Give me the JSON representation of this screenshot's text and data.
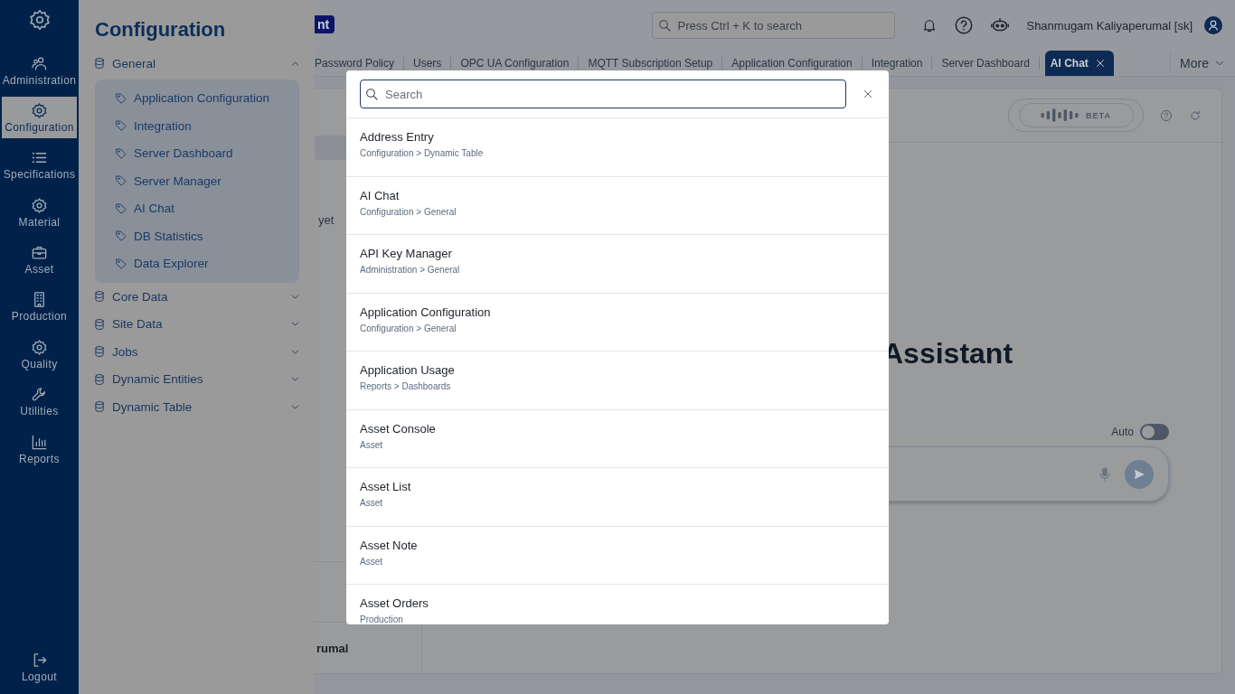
{
  "rail": {
    "items": [
      {
        "label": "Administration",
        "selected": false
      },
      {
        "label": "Configuration",
        "selected": true
      },
      {
        "label": "Specifications",
        "selected": false
      },
      {
        "label": "Material",
        "selected": false
      },
      {
        "label": "Asset",
        "selected": false
      },
      {
        "label": "Production",
        "selected": false
      },
      {
        "label": "Quality",
        "selected": false
      },
      {
        "label": "Utilities",
        "selected": false
      },
      {
        "label": "Reports",
        "selected": false
      }
    ],
    "logout": "Logout"
  },
  "config_panel": {
    "title": "Configuration",
    "groups": [
      {
        "label": "General",
        "expanded": true,
        "children": [
          {
            "label": "Application Configuration"
          },
          {
            "label": "Integration"
          },
          {
            "label": "Server Dashboard"
          },
          {
            "label": "Server Manager"
          },
          {
            "label": "AI Chat"
          },
          {
            "label": "DB Statistics"
          },
          {
            "label": "Data Explorer"
          }
        ]
      },
      {
        "label": "Core Data",
        "expanded": false
      },
      {
        "label": "Site Data",
        "expanded": false
      },
      {
        "label": "Jobs",
        "expanded": false
      },
      {
        "label": "Dynamic Entities",
        "expanded": false
      },
      {
        "label": "Dynamic Table",
        "expanded": false
      }
    ]
  },
  "header": {
    "brand_fragment": "nt",
    "search": {
      "placeholder": "Press Ctrl + K to search"
    },
    "user": "Shanmugam Kaliyaperumal [sk]"
  },
  "tabs": [
    {
      "label": "Password Policy",
      "selected": false
    },
    {
      "label": "Users",
      "selected": false
    },
    {
      "label": "OPC UA Configuration",
      "selected": false
    },
    {
      "label": "MQTT Subscription Setup",
      "selected": false
    },
    {
      "label": "Application Configuration",
      "selected": false
    },
    {
      "label": "Integration",
      "selected": false
    },
    {
      "label": "Server Dashboard",
      "selected": false
    },
    {
      "label": "AI Chat",
      "selected": true
    }
  ],
  "more": "More",
  "main": {
    "fragments": [
      "yet",
      "rumal"
    ],
    "beta": "BETA",
    "heading": "Assistant",
    "auto": {
      "label": "Auto",
      "on": false
    }
  },
  "search_dialog": {
    "search": {
      "placeholder": "Search"
    },
    "results": [
      {
        "title": "Address Entry",
        "path": "Configuration > Dynamic Table"
      },
      {
        "title": "AI Chat",
        "path": "Configuration > General"
      },
      {
        "title": "API Key Manager",
        "path": "Administration > General"
      },
      {
        "title": "Application Configuration",
        "path": "Configuration > General"
      },
      {
        "title": "Application Usage",
        "path": "Reports > Dashboards"
      },
      {
        "title": "Asset Console",
        "path": "Asset"
      },
      {
        "title": "Asset List",
        "path": "Asset"
      },
      {
        "title": "Asset Note",
        "path": "Asset"
      },
      {
        "title": "Asset Orders",
        "path": "Production"
      }
    ]
  }
}
